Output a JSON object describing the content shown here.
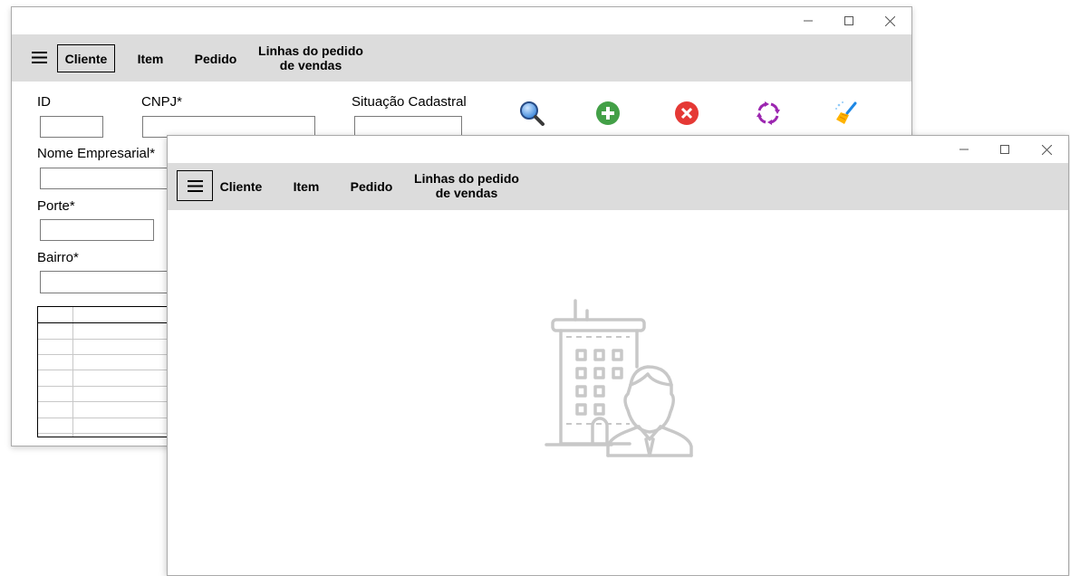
{
  "window_back": {
    "nav": {
      "menu_icon": "hamburger-icon",
      "items": [
        {
          "label": "Cliente",
          "selected": true
        },
        {
          "label": "Item"
        },
        {
          "label": "Pedido"
        },
        {
          "label": "Linhas do pedido de vendas"
        }
      ]
    },
    "form": {
      "id_label": "ID",
      "cnpj_label": "CNPJ*",
      "situacao_label": "Situação Cadastral",
      "nome_label": "Nome Empresarial*",
      "porte_label": "Porte*",
      "bairro_label": "Bairro*"
    },
    "actions": [
      {
        "icon": "search-icon",
        "color": "#3a7bd5"
      },
      {
        "icon": "add-icon",
        "color": "#4caf50"
      },
      {
        "icon": "delete-icon",
        "color": "#e53935"
      },
      {
        "icon": "refresh-icon",
        "color": "#9c27b0"
      },
      {
        "icon": "clean-brush-icon",
        "color": "#1e88e5"
      }
    ]
  },
  "window_front": {
    "nav": {
      "menu_icon": "hamburger-icon",
      "items": [
        {
          "label": "Cliente"
        },
        {
          "label": "Item"
        },
        {
          "label": "Pedido"
        },
        {
          "label": "Linhas do pedido de vendas"
        }
      ]
    },
    "illustration": "building-businessman-icon"
  },
  "colors": {
    "navbar_bg": "#dcdcdc",
    "illustration_gray": "#c8c8c8"
  }
}
